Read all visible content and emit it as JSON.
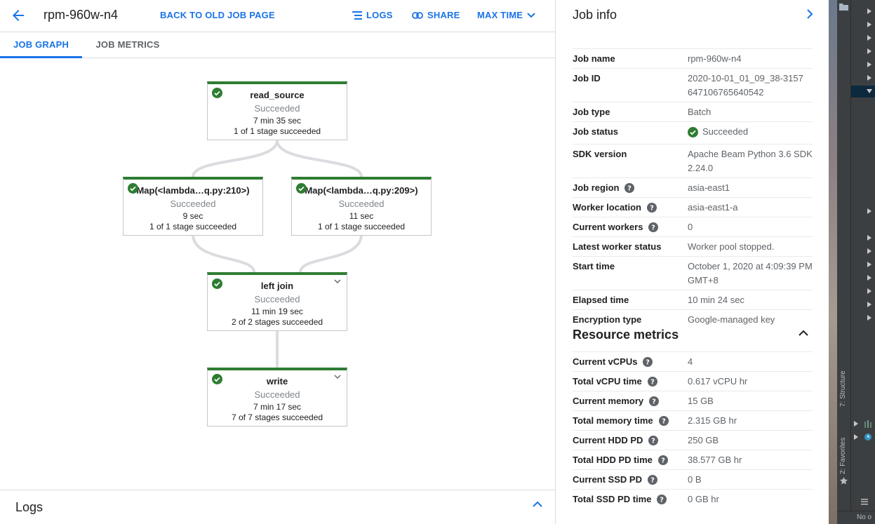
{
  "header": {
    "job_title": "rpm-960w-n4",
    "back_old_label": "BACK TO OLD JOB PAGE",
    "logs_label": "LOGS",
    "share_label": "SHARE",
    "max_time_label": "MAX TIME"
  },
  "tabs": [
    {
      "label": "JOB GRAPH",
      "active": true
    },
    {
      "label": "JOB METRICS",
      "active": false
    }
  ],
  "graph": {
    "nodes": [
      {
        "name": "read_source",
        "status": "Succeeded",
        "time": "7 min 35 sec",
        "stages": "1 of 1 stage succeeded",
        "expandable": false
      },
      {
        "name": "Map(<lambda…q.py:210>)",
        "status": "Succeeded",
        "time": "9 sec",
        "stages": "1 of 1 stage succeeded",
        "expandable": false
      },
      {
        "name": "Map(<lambda…q.py:209>)",
        "status": "Succeeded",
        "time": "11 sec",
        "stages": "1 of 1 stage succeeded",
        "expandable": false
      },
      {
        "name": "left join",
        "status": "Succeeded",
        "time": "11 min 19 sec",
        "stages": "2 of 2 stages succeeded",
        "expandable": true
      },
      {
        "name": "write",
        "status": "Succeeded",
        "time": "7 min 17 sec",
        "stages": "7 of 7 stages succeeded",
        "expandable": true
      }
    ]
  },
  "logs_panel": {
    "title": "Logs"
  },
  "job_info": {
    "title": "Job info",
    "rows": [
      {
        "key": "Job name",
        "value": "rpm-960w-n4"
      },
      {
        "key": "Job ID",
        "value": "2020-10-01_01_09_38-3157647106765640542"
      },
      {
        "key": "Job type",
        "value": "Batch"
      },
      {
        "key": "Job status",
        "value": "Succeeded"
      },
      {
        "key": "SDK version",
        "value": "Apache Beam Python 3.6 SDK 2.24.0"
      },
      {
        "key": "Job region",
        "value": "asia-east1"
      },
      {
        "key": "Worker location",
        "value": "asia-east1-a"
      },
      {
        "key": "Current workers",
        "value": "0"
      },
      {
        "key": "Latest worker status",
        "value": "Worker pool stopped."
      },
      {
        "key": "Start time",
        "value": "October 1, 2020 at 4:09:39 PM GMT+8"
      },
      {
        "key": "Elapsed time",
        "value": "10 min 24 sec"
      },
      {
        "key": "Encryption type",
        "value": "Google-managed key"
      }
    ]
  },
  "resource_metrics": {
    "title": "Resource metrics",
    "rows": [
      {
        "key": "Current vCPUs",
        "value": "4"
      },
      {
        "key": "Total vCPU time",
        "value": "0.617 vCPU hr"
      },
      {
        "key": "Current memory",
        "value": "15 GB"
      },
      {
        "key": "Total memory time",
        "value": "2.315 GB hr"
      },
      {
        "key": "Current HDD PD",
        "value": "250 GB"
      },
      {
        "key": "Total HDD PD time",
        "value": "38.577 GB hr"
      },
      {
        "key": "Current SSD PD",
        "value": "0 B"
      },
      {
        "key": "Total SSD PD time",
        "value": "0 GB hr"
      }
    ]
  },
  "ide": {
    "structure_label": "7: Structure",
    "favorites_label": "2: Favorites",
    "status_text": "No o"
  },
  "colors": {
    "accent": "#1a73e8",
    "success": "#2e7d32"
  }
}
